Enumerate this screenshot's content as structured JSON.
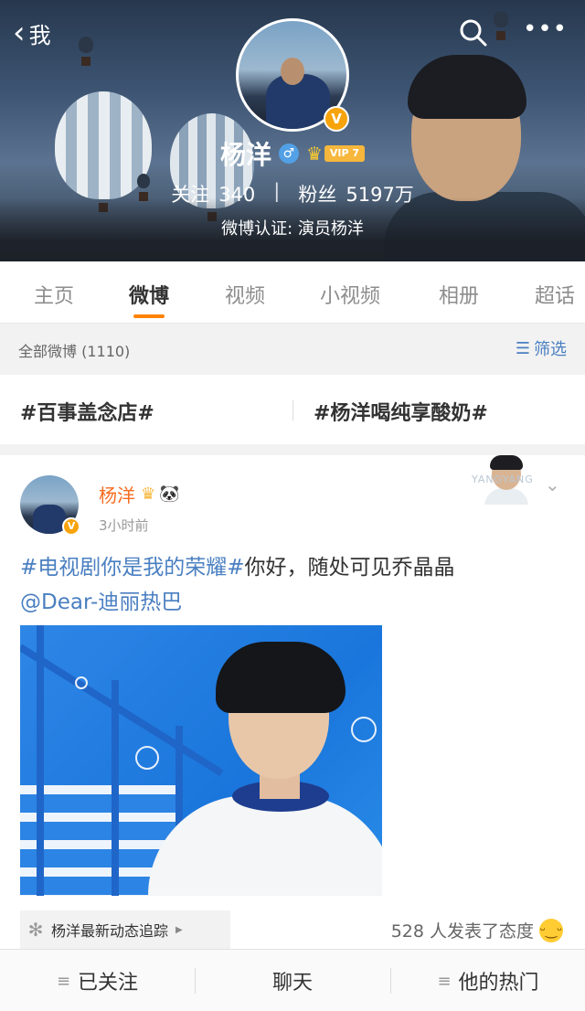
{
  "nav": {
    "back_label": "我",
    "back_icon": "chevron-left-icon",
    "search_icon": "search-icon",
    "more_icon": "more-horizontal-icon"
  },
  "profile": {
    "name": "杨洋",
    "gender_symbol": "♂",
    "vip_label": "VIP 7",
    "verified_badge": "V",
    "following_label": "关注",
    "following_count": "340",
    "followers_label": "粉丝",
    "followers_count": "5197万",
    "verification": "微博认证: 演员杨洋"
  },
  "tabs": [
    {
      "label": "主页",
      "active": false
    },
    {
      "label": "微博",
      "active": true
    },
    {
      "label": "视频",
      "active": false
    },
    {
      "label": "小视频",
      "active": false
    },
    {
      "label": "相册",
      "active": false
    },
    {
      "label": "超话",
      "active": false
    }
  ],
  "filter": {
    "all_label": "全部微博 (1110)",
    "filter_label": "筛选"
  },
  "topics": [
    "#百事盖念店#",
    "#杨洋喝纯享酸奶#"
  ],
  "post": {
    "author": "杨洋",
    "time": "3小时前",
    "verified_badge": "V",
    "card_watermark": "YANGYANG",
    "text_hashtag": "#电视剧你是我的荣耀#",
    "text_body": "你好，随处可见乔晶晶",
    "text_mention": "@Dear-迪丽热巴",
    "tracker_label": "杨洋最新动态追踪",
    "attitude_text": "528 人发表了态度"
  },
  "bottom_bar": [
    {
      "label": "已关注",
      "icon": "menu-lines-icon"
    },
    {
      "label": "聊天",
      "icon": ""
    },
    {
      "label": "他的热门",
      "icon": "menu-lines-icon"
    }
  ],
  "colors": {
    "accent": "#ff8200",
    "link": "#4a7fc1",
    "author_name": "#f86b1f"
  }
}
